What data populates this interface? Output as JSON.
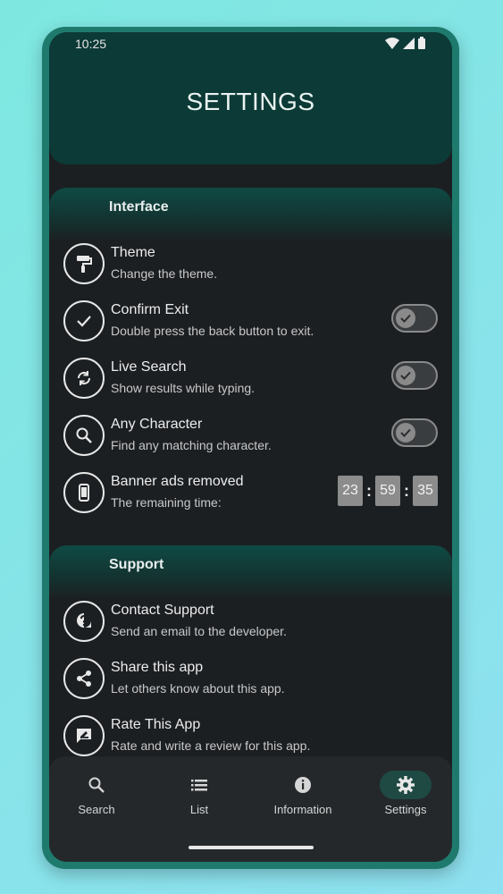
{
  "status": {
    "time": "10:25"
  },
  "header": {
    "title": "SETTINGS"
  },
  "interface": {
    "title": "Interface",
    "theme": {
      "title": "Theme",
      "subtitle": "Change the theme."
    },
    "confirm_exit": {
      "title": "Confirm Exit",
      "subtitle": "Double press the back button to exit.",
      "enabled": true
    },
    "live_search": {
      "title": "Live Search",
      "subtitle": "Show results while typing.",
      "enabled": true
    },
    "any_character": {
      "title": "Any Character",
      "subtitle": "Find any matching character.",
      "enabled": true
    },
    "banner_ads": {
      "title": "Banner ads removed",
      "subtitle": "The remaining time:",
      "hours": "23",
      "minutes": "59",
      "seconds": "35"
    }
  },
  "support": {
    "title": "Support",
    "contact": {
      "title": "Contact Support",
      "subtitle": "Send an email to the developer."
    },
    "share": {
      "title": "Share this app",
      "subtitle": "Let others know about this app."
    },
    "rate": {
      "title": "Rate This App",
      "subtitle": "Rate and write a review for this app."
    }
  },
  "nav": {
    "search": "Search",
    "list": "List",
    "information": "Information",
    "settings": "Settings",
    "active": "settings"
  },
  "colors": {
    "header": "#0c3a36",
    "background": "#1c1f22",
    "frame": "#1f7a6e",
    "active_nav": "#1f4a44"
  }
}
